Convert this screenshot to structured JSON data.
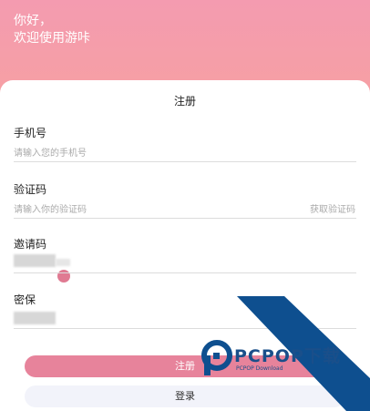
{
  "header": {
    "greeting_line1": "你好，",
    "greeting_line2": "欢迎使用游咔"
  },
  "form": {
    "title": "注册",
    "phone": {
      "label": "手机号",
      "placeholder": "请输入您的手机号"
    },
    "code": {
      "label": "验证码",
      "placeholder": "请输入你的验证码",
      "action": "获取验证码"
    },
    "invite": {
      "label": "邀请码"
    },
    "password": {
      "label": "密保"
    }
  },
  "buttons": {
    "register": "注册",
    "login": "登录"
  },
  "watermark": {
    "brand": "PCPOP下载",
    "sub": "PCPOP Download"
  },
  "colors": {
    "header_gradient_top": "#f49bb0",
    "header_gradient_bottom": "#f6a0a3",
    "primary_button": "#e7839b",
    "secondary_button": "#f2f3fa",
    "watermark_blue": "#0e4f8f"
  }
}
